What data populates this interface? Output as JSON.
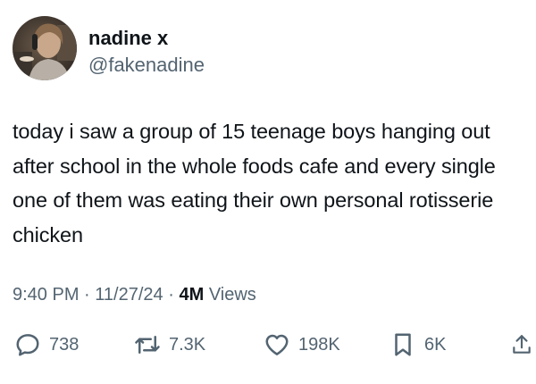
{
  "user": {
    "display_name": "nadine x",
    "handle": "@fakenadine"
  },
  "tweet": {
    "text": "today i saw a group of 15 teenage boys hanging out after school in the whole foods cafe and every single one of them was eating their own personal rotisserie chicken"
  },
  "meta": {
    "time": "9:40 PM",
    "separator": "·",
    "date": "11/27/24",
    "views_count": "4M",
    "views_label": "Views"
  },
  "actions": {
    "replies": "738",
    "retweets": "7.3K",
    "likes": "198K",
    "bookmarks": "6K"
  },
  "icons": {
    "reply": "speech-bubble-icon",
    "retweet": "retweet-arrows-icon",
    "like": "heart-icon",
    "bookmark": "bookmark-icon",
    "share": "share-upload-icon"
  },
  "colors": {
    "text": "#0f1419",
    "secondary": "#536471",
    "background": "#ffffff"
  }
}
